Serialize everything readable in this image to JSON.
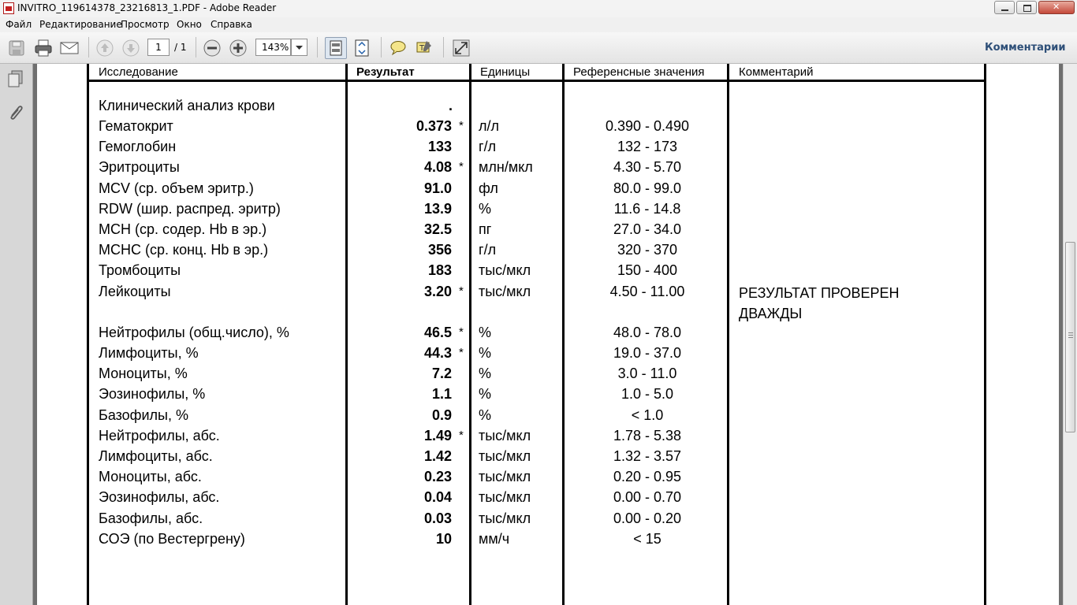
{
  "window": {
    "title": "INVITRO_119614378_23216813_1.PDF - Adobe Reader"
  },
  "menu": [
    "Файл",
    "Редактирование",
    "Просмотр",
    "Окно",
    "Справка"
  ],
  "toolbar": {
    "page_current": "1",
    "page_total": "/ 1",
    "zoom": "143%",
    "comments_label": "Комментарии"
  },
  "table": {
    "headers": {
      "study": "Исследование",
      "result": "Результат",
      "units": "Единицы",
      "reference": "Референсные значения",
      "comment": "Комментарий"
    },
    "section_title": "Клинический анализ крови",
    "section_marker": ".",
    "rows": [
      {
        "name": "Гематокрит",
        "result": "0.373",
        "flag": "*",
        "unit": "л/л",
        "ref": "0.390 - 0.490"
      },
      {
        "name": "Гемоглобин",
        "result": "133",
        "flag": "",
        "unit": "г/л",
        "ref": "132 - 173"
      },
      {
        "name": "Эритроциты",
        "result": "4.08",
        "flag": "*",
        "unit": "млн/мкл",
        "ref": "4.30 - 5.70"
      },
      {
        "name": "MCV (ср. объем эритр.)",
        "result": "91.0",
        "flag": "",
        "unit": "фл",
        "ref": "80.0 - 99.0"
      },
      {
        "name": "RDW (шир. распред. эритр)",
        "result": "13.9",
        "flag": "",
        "unit": "%",
        "ref": "11.6 - 14.8"
      },
      {
        "name": "MCH (ср. содер. Hb в эр.)",
        "result": "32.5",
        "flag": "",
        "unit": "пг",
        "ref": "27.0 - 34.0"
      },
      {
        "name": "MCHC (ср. конц. Hb в эр.)",
        "result": "356",
        "flag": "",
        "unit": "г/л",
        "ref": "320 - 370"
      },
      {
        "name": "Тромбоциты",
        "result": "183",
        "flag": "",
        "unit": "тыс/мкл",
        "ref": "150 - 400"
      },
      {
        "name": "Лейкоциты",
        "result": "3.20",
        "flag": "*",
        "unit": "тыс/мкл",
        "ref": "4.50 - 11.00"
      },
      {
        "name": "Нейтрофилы (общ.число), %",
        "result": "46.5",
        "flag": "*",
        "unit": "%",
        "ref": "48.0 - 78.0"
      },
      {
        "name": "Лимфоциты, %",
        "result": "44.3",
        "flag": "*",
        "unit": "%",
        "ref": "19.0 - 37.0"
      },
      {
        "name": "Моноциты, %",
        "result": "7.2",
        "flag": "",
        "unit": "%",
        "ref": "3.0 - 11.0"
      },
      {
        "name": "Эозинофилы, %",
        "result": "1.1",
        "flag": "",
        "unit": "%",
        "ref": "1.0 - 5.0"
      },
      {
        "name": "Базофилы, %",
        "result": "0.9",
        "flag": "",
        "unit": "%",
        "ref": "< 1.0"
      },
      {
        "name": "Нейтрофилы, абс.",
        "result": "1.49",
        "flag": "*",
        "unit": "тыс/мкл",
        "ref": "1.78 - 5.38"
      },
      {
        "name": "Лимфоциты, абс.",
        "result": "1.42",
        "flag": "",
        "unit": "тыс/мкл",
        "ref": "1.32 - 3.57"
      },
      {
        "name": "Моноциты, абс.",
        "result": "0.23",
        "flag": "",
        "unit": "тыс/мкл",
        "ref": "0.20 - 0.95"
      },
      {
        "name": "Эозинофилы, абс.",
        "result": "0.04",
        "flag": "",
        "unit": "тыс/мкл",
        "ref": "0.00 - 0.70"
      },
      {
        "name": "Базофилы, абс.",
        "result": "0.03",
        "flag": "",
        "unit": "тыс/мкл",
        "ref": "0.00 - 0.20"
      },
      {
        "name": "СОЭ (по Вестергрену)",
        "result": "10",
        "flag": "",
        "unit": "мм/ч",
        "ref": "< 15"
      }
    ],
    "comment_line1": "РЕЗУЛЬТАТ ПРОВЕРЕН",
    "comment_line2": "ДВАЖДЫ"
  },
  "colors": {
    "comments_link": "#2e4f78",
    "document_bg": "#ffffff",
    "window_bg": "#6f6f6f"
  }
}
